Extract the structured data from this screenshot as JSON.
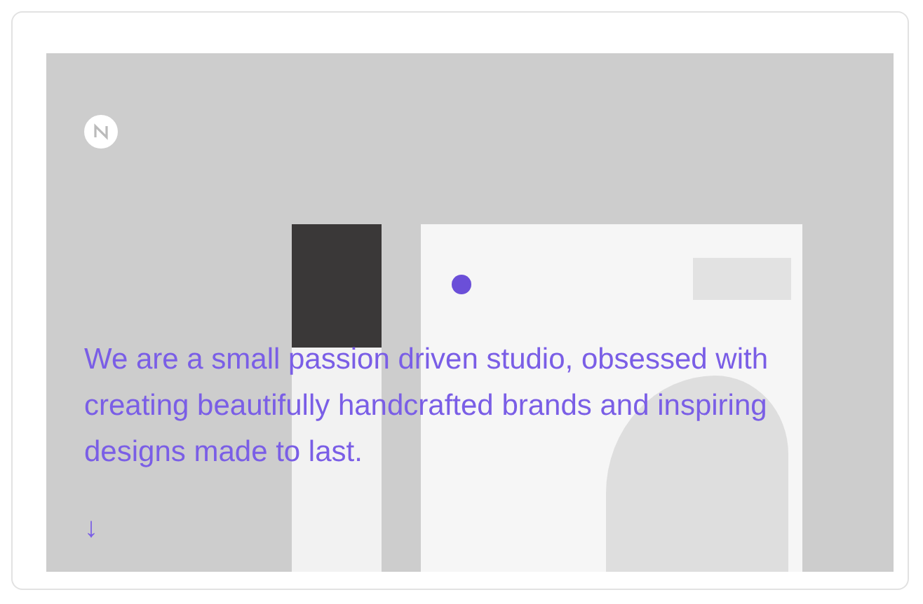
{
  "hero": {
    "headline": "We are a small passion driven studio, obsessed with creating beautifully handcrafted brands and inspiring designs made to last.",
    "scroll_arrow": "↓"
  }
}
